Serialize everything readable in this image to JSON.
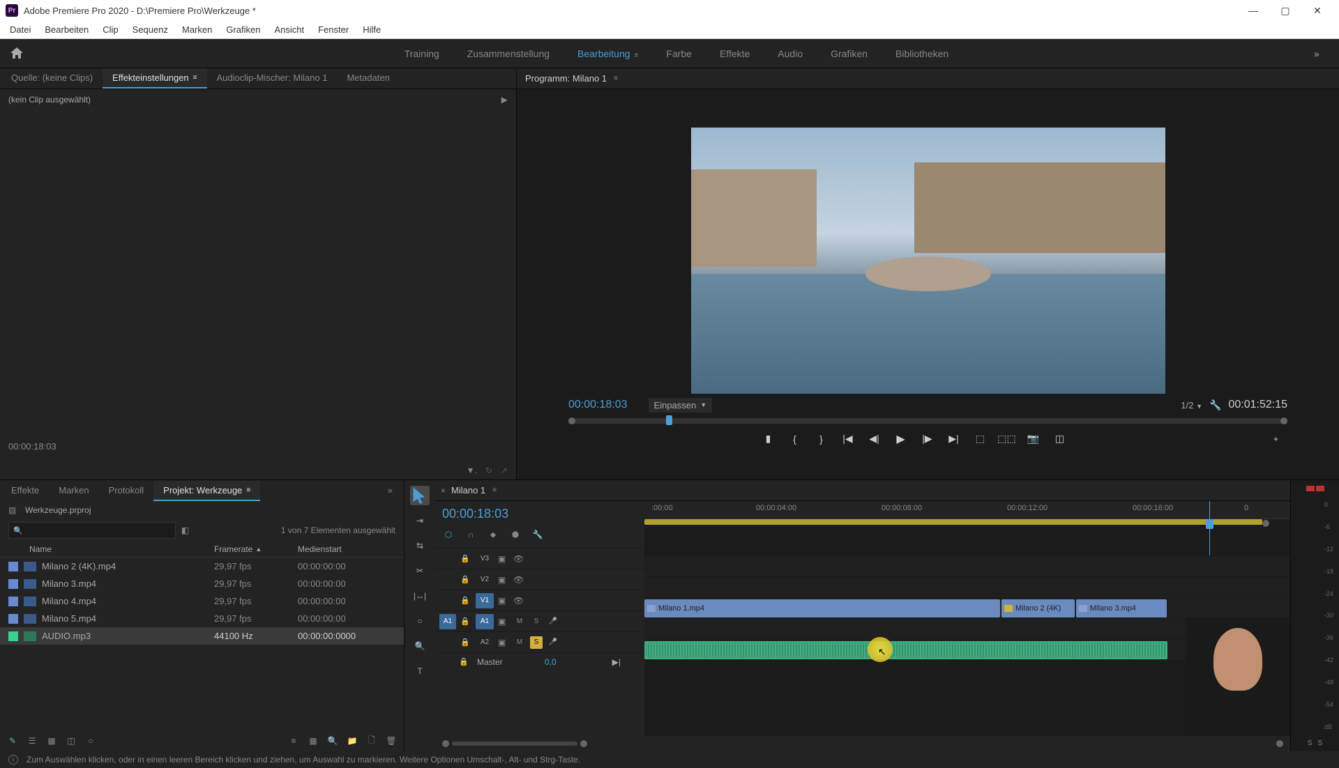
{
  "window": {
    "title": "Adobe Premiere Pro 2020 - D:\\Premiere Pro\\Werkzeuge *"
  },
  "menu": [
    "Datei",
    "Bearbeiten",
    "Clip",
    "Sequenz",
    "Marken",
    "Grafiken",
    "Ansicht",
    "Fenster",
    "Hilfe"
  ],
  "workspaces": {
    "items": [
      "Training",
      "Zusammenstellung",
      "Bearbeitung",
      "Farbe",
      "Effekte",
      "Audio",
      "Grafiken",
      "Bibliotheken"
    ],
    "active": "Bearbeitung"
  },
  "source_tabs": {
    "items": [
      "Quelle: (keine Clips)",
      "Effekteinstellungen",
      "Audioclip-Mischer: Milano 1",
      "Metadaten"
    ],
    "active_index": 1
  },
  "fx_panel": {
    "noclip": "(kein Clip ausgewählt)",
    "timecode": "00:00:18:03"
  },
  "program": {
    "title": "Programm: Milano 1",
    "tc_left": "00:00:18:03",
    "fit": "Einpassen",
    "zoom": "1/2",
    "tc_right": "00:01:52:15"
  },
  "project_tabs": {
    "items": [
      "Effekte",
      "Marken",
      "Protokoll",
      "Projekt: Werkzeuge"
    ],
    "active_index": 3
  },
  "project": {
    "filename": "Werkzeuge.prproj",
    "selection": "1 von 7 Elementen ausgewählt",
    "columns": {
      "name": "Name",
      "framerate": "Framerate",
      "mediastart": "Medienstart"
    },
    "rows": [
      {
        "name": "Milano 2 (4K).mp4",
        "fr": "29,97 fps",
        "ms": "00:00:00:00",
        "type": "video",
        "sel": false
      },
      {
        "name": "Milano 3.mp4",
        "fr": "29,97 fps",
        "ms": "00:00:00:00",
        "type": "video",
        "sel": false
      },
      {
        "name": "Milano 4.mp4",
        "fr": "29,97 fps",
        "ms": "00:00:00:00",
        "type": "video",
        "sel": false
      },
      {
        "name": "Milano 5.mp4",
        "fr": "29,97 fps",
        "ms": "00:00:00:00",
        "type": "video",
        "sel": false
      },
      {
        "name": "AUDIO.mp3",
        "fr": "44100 Hz",
        "ms": "00:00:00:0000",
        "type": "audio",
        "sel": true
      }
    ]
  },
  "timeline": {
    "seq_name": "Milano 1",
    "tc": "00:00:18:03",
    "ruler": [
      ":00:00",
      "00:00:04:00",
      "00:00:08:00",
      "00:00:12:00",
      "00:00:16:00",
      "0"
    ],
    "tracks": {
      "v3": "V3",
      "v2": "V2",
      "v1": "V1",
      "a1_src": "A1",
      "a1": "A1",
      "a2": "A2",
      "master": "Master",
      "master_val": "0,0",
      "mute": "M",
      "solo": "S"
    },
    "clips": {
      "v1a": "Milano 1.mp4",
      "v1b": "Milano 2 (4K)",
      "v1c": "Milano 3.mp4"
    }
  },
  "meters": {
    "scale": [
      "0",
      "-6",
      "-12",
      "-18",
      "-24",
      "-30",
      "-36",
      "-42",
      "-48",
      "-54",
      "dB"
    ],
    "solo": "S"
  },
  "status": {
    "text": "Zum Auswählen klicken, oder in einen leeren Bereich klicken und ziehen, um Auswahl zu markieren. Weitere Optionen Umschalt-, Alt- und Strg-Taste."
  }
}
